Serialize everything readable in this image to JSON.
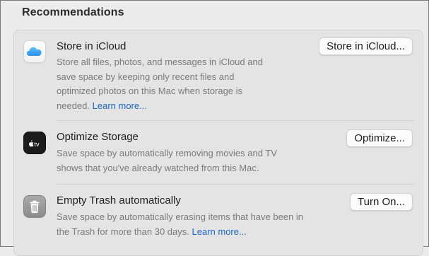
{
  "header": {
    "title": "Recommendations"
  },
  "recommendations": [
    {
      "title": "Store in iCloud",
      "description_lines": [
        "Store all files, photos, and messages in iCloud and",
        "save space by keeping only recent files and",
        "optimized photos on this Mac when storage is",
        "needed."
      ],
      "learn_more": "Learn more...",
      "button_label": "Store in iCloud...",
      "icon": "icloud-icon"
    },
    {
      "title": "Optimize Storage",
      "description_lines": [
        "Save space by automatically removing movies and TV",
        "shows that you've already watched from this Mac."
      ],
      "button_label": "Optimize...",
      "icon": "apple-tv-icon",
      "icon_text": "tv"
    },
    {
      "title": "Empty Trash automatically",
      "description_lines": [
        "Save space by automatically erasing items that have been in",
        "the Trash for more than 30 days."
      ],
      "learn_more": "Learn more...",
      "button_label": "Turn On...",
      "icon": "trash-icon"
    }
  ],
  "colors": {
    "background": "#ececec",
    "link": "#1d66c9",
    "secondary_text": "#7b7b7b"
  }
}
